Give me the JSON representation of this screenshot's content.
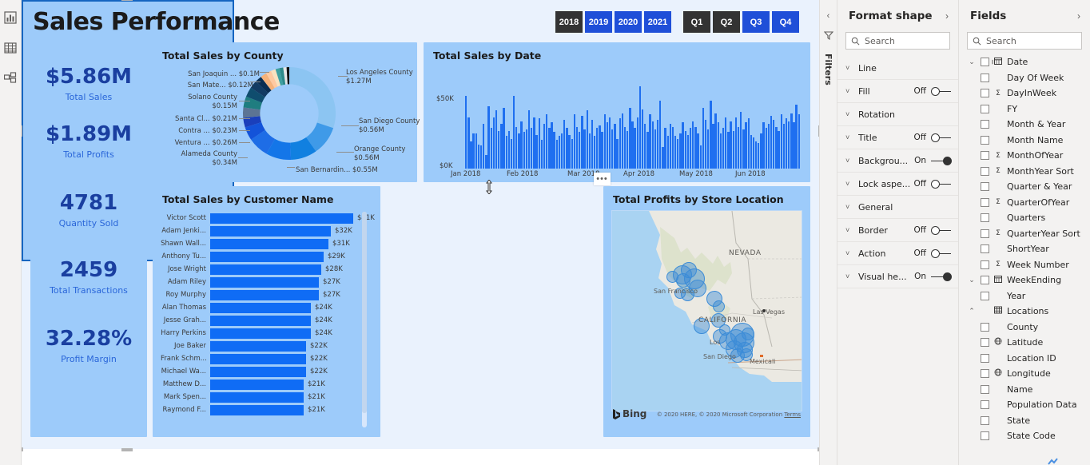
{
  "app": {
    "left_rail_icons": [
      "report-view-icon",
      "data-view-icon",
      "model-view-icon"
    ],
    "filters_label": "Filters"
  },
  "report": {
    "title": "Sales Performance",
    "slicer_years": [
      {
        "label": "2018",
        "selected": true
      },
      {
        "label": "2019",
        "selected": false
      },
      {
        "label": "2020",
        "selected": false
      },
      {
        "label": "2021",
        "selected": false
      }
    ],
    "slicer_quarters": [
      {
        "label": "Q1",
        "selected": true
      },
      {
        "label": "Q2",
        "selected": true
      },
      {
        "label": "Q3",
        "selected": false
      },
      {
        "label": "Q4",
        "selected": false
      }
    ],
    "kpis": [
      {
        "value": "$5.86M",
        "label": "Total Sales"
      },
      {
        "value": "$1.89M",
        "label": "Total Profits"
      },
      {
        "value": "4781",
        "label": "Quantity Sold"
      },
      {
        "value": "2459",
        "label": "Total Transactions"
      },
      {
        "value": "32.28%",
        "label": "Profit Margin"
      }
    ],
    "ellipsis_label": "•••"
  },
  "chart_data": [
    {
      "type": "pie",
      "title": "Total Sales by County",
      "subtype": "donut",
      "labels": [
        "Los Angeles County",
        "San Diego County",
        "Orange County",
        "San Bernardin...",
        "Alameda County",
        "Ventura ...",
        "Contra ...",
        "Santa Cl...",
        "Solano County",
        "San Mate...",
        "San Joaquin ..."
      ],
      "values": [
        1.27,
        0.56,
        0.56,
        0.55,
        0.34,
        0.26,
        0.23,
        0.21,
        0.15,
        0.12,
        0.1
      ],
      "value_labels": [
        "$1.27M",
        "$0.56M",
        "$0.56M",
        "$0.55M",
        "$0.34M",
        "$0.26M",
        "$0.23M",
        "$0.21M",
        "$0.15M",
        "$0.12M",
        "$0.1M"
      ],
      "display_labels": [
        "Los Angeles County\n$1.27M",
        "San Diego County\n$0.56M",
        "Orange County\n$0.56M",
        "San Bernardin... $0.55M",
        "Alameda County\n$0.34M",
        "Ventura ... $0.26M",
        "Contra ... $0.23M",
        "Santa Cl... $0.21M",
        "Solano County\n$0.15M",
        "San Mate... $0.12M",
        "San Joaquin ... $0.1M"
      ],
      "unit": "M USD",
      "legend": "labels-on-slices"
    },
    {
      "type": "bar",
      "title": "Total Sales by Customer Name",
      "orientation": "horizontal",
      "categories": [
        "Victor Scott",
        "Adam Jenki...",
        "Shawn Wall...",
        "Anthony Tu...",
        "Jose Wright",
        "Adam Riley",
        "Roy Murphy",
        "Alan Thomas",
        "Jesse Grah...",
        "Harry Perkins",
        "Joe Baker",
        "Frank Schm...",
        "Michael Wa...",
        "Matthew D...",
        "Mark Spen...",
        "Raymond F..."
      ],
      "values": [
        41,
        32,
        31,
        29,
        28,
        27,
        27,
        24,
        24,
        24,
        22,
        22,
        22,
        21,
        21,
        21
      ],
      "value_labels": [
        "$41K",
        "$32K",
        "$31K",
        "$29K",
        "$28K",
        "$27K",
        "$27K",
        "$24K",
        "$24K",
        "$24K",
        "$22K",
        "$22K",
        "$22K",
        "$21K",
        "$21K",
        "$21K"
      ],
      "xlabel": "",
      "ylabel": "",
      "xlim": [
        0,
        50
      ],
      "grid": false,
      "bar_color": "#0f6cf5",
      "scrollable": true
    },
    {
      "type": "bar",
      "title": "Total Sales by Date",
      "orientation": "vertical",
      "xlabel": "",
      "ylabel": "",
      "ytick_labels": [
        "$0K",
        "$50K"
      ],
      "ylim": [
        0,
        65
      ],
      "xtick_labels": [
        "Jan 2018",
        "Feb 2018",
        "Mar 2018",
        "Apr 2018",
        "May 2018",
        "Jun 2018"
      ],
      "grid": false,
      "bar_color": "#1f6ff0",
      "values": [
        54,
        38,
        20,
        26,
        26,
        18,
        17,
        33,
        10,
        46,
        30,
        38,
        43,
        28,
        33,
        45,
        24,
        28,
        22,
        54,
        31,
        26,
        35,
        27,
        29,
        43,
        30,
        38,
        25,
        37,
        21,
        33,
        40,
        30,
        34,
        27,
        21,
        24,
        26,
        36,
        30,
        25,
        22,
        40,
        31,
        27,
        39,
        29,
        43,
        26,
        36,
        24,
        30,
        32,
        27,
        40,
        34,
        38,
        29,
        33,
        22,
        37,
        41,
        31,
        28,
        45,
        35,
        30,
        38,
        61,
        44,
        33,
        27,
        40,
        35,
        29,
        36,
        50,
        16,
        30,
        24,
        33,
        31,
        24,
        22,
        26,
        34,
        28,
        25,
        30,
        35,
        31,
        26,
        17,
        45,
        36,
        29,
        50,
        33,
        41,
        34,
        26,
        30,
        38,
        27,
        35,
        28,
        38,
        31,
        42,
        29,
        34,
        37,
        25,
        23,
        20,
        19,
        26,
        34,
        30,
        33,
        39,
        36,
        31,
        28,
        40,
        33,
        37,
        35,
        41,
        34,
        47,
        40
      ]
    },
    {
      "type": "scatter",
      "title": "Total Profits by Store Location",
      "subtype": "map",
      "basemap": "Bing",
      "map_labels": [
        "NEVADA",
        "CALIFORNIA",
        "San Francisco",
        "Las Vegas",
        "Los",
        "San Diego",
        "Mexicali"
      ],
      "credit": "© 2020 HERE, © 2020 Microsoft Corporation",
      "terms_link": "Terms",
      "bing_label": "Bing"
    }
  ],
  "format_panel": {
    "title": "Format shape",
    "search_placeholder": "Search",
    "rows": [
      {
        "label": "Line",
        "state": ""
      },
      {
        "label": "Fill",
        "state": "Off"
      },
      {
        "label": "Rotation",
        "state": ""
      },
      {
        "label": "Title",
        "state": "Off"
      },
      {
        "label": "Backgrou...",
        "state": "On"
      },
      {
        "label": "Lock aspe...",
        "state": "Off"
      },
      {
        "label": "General",
        "state": ""
      },
      {
        "label": "Border",
        "state": "Off"
      },
      {
        "label": "Action",
        "state": "Off"
      },
      {
        "label": "Visual he...",
        "state": "On"
      }
    ]
  },
  "fields_panel": {
    "title": "Fields",
    "search_placeholder": "Search",
    "items": [
      {
        "label": "Date",
        "level": 1,
        "caret": "⌄",
        "icon": "calendar-icon",
        "checkbox": true
      },
      {
        "label": "Day Of Week",
        "level": 2,
        "caret": "",
        "icon": "",
        "checkbox": true
      },
      {
        "label": "DayInWeek",
        "level": 2,
        "caret": "",
        "icon": "sigma-icon",
        "checkbox": true
      },
      {
        "label": "FY",
        "level": 2,
        "caret": "",
        "icon": "",
        "checkbox": true
      },
      {
        "label": "Month & Year",
        "level": 2,
        "caret": "",
        "icon": "",
        "checkbox": true
      },
      {
        "label": "Month Name",
        "level": 2,
        "caret": "",
        "icon": "",
        "checkbox": true
      },
      {
        "label": "MonthOfYear",
        "level": 2,
        "caret": "",
        "icon": "sigma-icon",
        "checkbox": true
      },
      {
        "label": "MonthYear Sort",
        "level": 2,
        "caret": "",
        "icon": "sigma-icon",
        "checkbox": true
      },
      {
        "label": "Quarter & Year",
        "level": 2,
        "caret": "",
        "icon": "",
        "checkbox": true
      },
      {
        "label": "QuarterOfYear",
        "level": 2,
        "caret": "",
        "icon": "sigma-icon",
        "checkbox": true
      },
      {
        "label": "Quarters",
        "level": 2,
        "caret": "",
        "icon": "",
        "checkbox": true
      },
      {
        "label": "QuarterYear Sort",
        "level": 2,
        "caret": "",
        "icon": "sigma-icon",
        "checkbox": true
      },
      {
        "label": "ShortYear",
        "level": 2,
        "caret": "",
        "icon": "",
        "checkbox": true
      },
      {
        "label": "Week Number",
        "level": 2,
        "caret": "",
        "icon": "sigma-icon",
        "checkbox": true
      },
      {
        "label": "WeekEnding",
        "level": 1,
        "caret": "⌄",
        "icon": "calendar-icon",
        "checkbox": true
      },
      {
        "label": "Year",
        "level": 2,
        "caret": "",
        "icon": "",
        "checkbox": true
      },
      {
        "label": "Locations",
        "level": 1,
        "caret": "⌃",
        "icon": "table-icon",
        "checkbox": false
      },
      {
        "label": "County",
        "level": 2,
        "caret": "",
        "icon": "",
        "checkbox": true
      },
      {
        "label": "Latitude",
        "level": 2,
        "caret": "",
        "icon": "globe-icon",
        "checkbox": true
      },
      {
        "label": "Location ID",
        "level": 2,
        "caret": "",
        "icon": "",
        "checkbox": true
      },
      {
        "label": "Longitude",
        "level": 2,
        "caret": "",
        "icon": "globe-icon",
        "checkbox": true
      },
      {
        "label": "Name",
        "level": 2,
        "caret": "",
        "icon": "",
        "checkbox": true
      },
      {
        "label": "Population Data",
        "level": 2,
        "caret": "",
        "icon": "",
        "checkbox": true
      },
      {
        "label": "State",
        "level": 2,
        "caret": "",
        "icon": "",
        "checkbox": true
      },
      {
        "label": "State Code",
        "level": 2,
        "caret": "",
        "icon": "",
        "checkbox": true
      }
    ]
  },
  "colors": {
    "canvas_bg": "#eaf2fd",
    "visual_bg": "#9dcbfa",
    "kpi_value": "#1a3fa0",
    "kpi_label": "#2a66d9",
    "bar_blue": "#0f6cf5",
    "slicer_selected": "#333333",
    "slicer_unselected": "#1f4fd8",
    "selection_border": "#1565c0"
  }
}
